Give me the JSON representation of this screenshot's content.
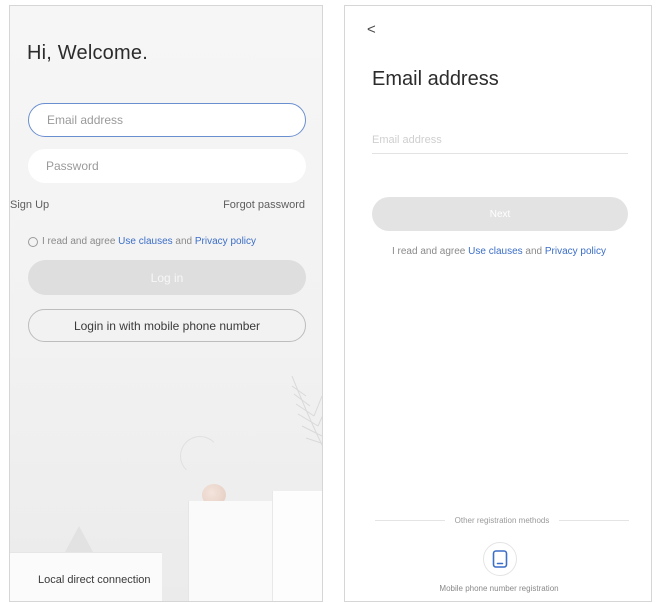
{
  "login_screen": {
    "greeting": "Hi, Welcome.",
    "email_placeholder": "Email address",
    "password_placeholder": "Password",
    "sign_up": "Sign Up",
    "forgot_password": "Forgot password",
    "agree_prefix": "I read and agree",
    "use_clauses": "Use clauses",
    "and": "and",
    "privacy_policy": "Privacy policy",
    "login_button": "Log in",
    "mobile_login_button": "Login in with mobile phone number",
    "local_connection": "Local direct connection"
  },
  "email_screen": {
    "back": "<",
    "title": "Email address",
    "email_placeholder": "Email address",
    "next_button": "Next",
    "agree_prefix": "I read and agree",
    "use_clauses": "Use clauses",
    "and": "and",
    "privacy_policy": "Privacy policy",
    "other_methods": "Other registration methods",
    "mobile_registration": "Mobile phone number registration",
    "mobile_icon": "tablet-icon"
  },
  "colors": {
    "link": "#3b6ec7",
    "active_border": "#6a8fd0",
    "disabled_button": "#dedede"
  }
}
